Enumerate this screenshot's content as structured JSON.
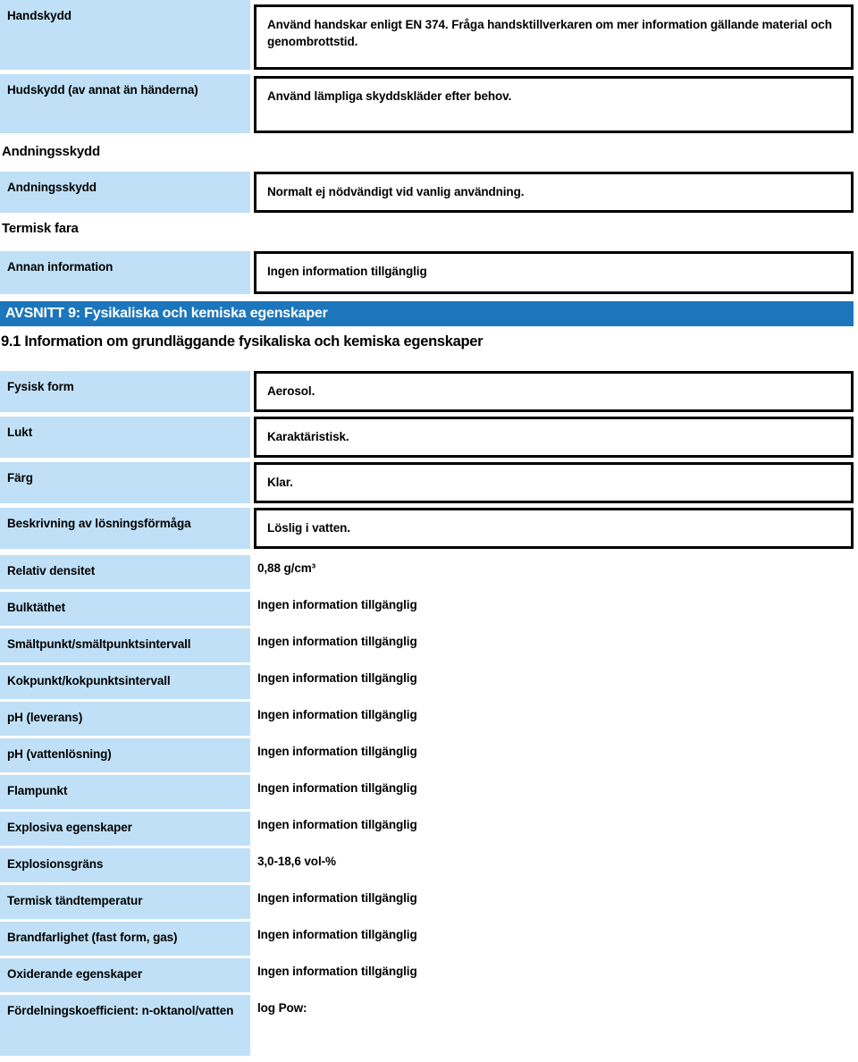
{
  "document": {
    "language": "sv",
    "kind": "safety-data-sheet"
  },
  "colors": {
    "label_cell": "#bfe0f6",
    "banner": "#1c76bc",
    "banner_text": "#ffffff",
    "box_border": "#000000",
    "page_background": "#ffffff",
    "text": "#000000"
  },
  "protection_section": {
    "rows": [
      {
        "label": "Handskydd",
        "value": "Använd handskar enligt EN 374. Fråga handsktillverkaren om mer information gällande material och genombrottstid.",
        "boxed": true
      },
      {
        "label": "Hudskydd (av annat än händerna)",
        "value": "Använd lämpliga skyddskläder efter behov.",
        "boxed": true
      }
    ],
    "subheadings": [
      {
        "text": "Andningsskydd"
      },
      {
        "text": "Termisk fara"
      }
    ],
    "respiratory_row": {
      "label": "Andningsskydd",
      "value": "Normalt ej nödvändigt vid vanlig användning.",
      "boxed": true
    },
    "other_info_row": {
      "label": "Annan information",
      "value": "Ingen information tillgänglig",
      "boxed": true
    }
  },
  "section9": {
    "banner": "AVSNITT 9: Fysikaliska och kemiska egenskaper",
    "subsection_heading": "9.1 Information om grundläggande fysikaliska och kemiska egenskaper",
    "boxed_rows": [
      {
        "label": "Fysisk form",
        "value": "Aerosol."
      },
      {
        "label": "Lukt",
        "value": "Karaktäristisk."
      },
      {
        "label": "Färg",
        "value": "Klar."
      },
      {
        "label": "Beskrivning av lösningsförmåga",
        "value": "Löslig i vatten."
      }
    ],
    "plain_rows": [
      {
        "label": "Relativ densitet",
        "value": "0,88 g/cm³"
      },
      {
        "label": "Bulktäthet",
        "value": "Ingen information tillgänglig"
      },
      {
        "label": "Smältpunkt/smältpunktsintervall",
        "value": "Ingen information tillgänglig"
      },
      {
        "label": "Kokpunkt/kokpunktsintervall",
        "value": "Ingen information tillgänglig"
      },
      {
        "label": "pH (leverans)",
        "value": "Ingen information tillgänglig"
      },
      {
        "label": "pH (vattenlösning)",
        "value": "Ingen information tillgänglig"
      },
      {
        "label": "Flampunkt",
        "value": "Ingen information tillgänglig"
      },
      {
        "label": "Explosiva egenskaper",
        "value": "Ingen information tillgänglig"
      },
      {
        "label": "Explosionsgräns",
        "value": "3,0-18,6 vol-%"
      },
      {
        "label": "Termisk tändtemperatur",
        "value": "Ingen information tillgänglig"
      },
      {
        "label": "Brandfarlighet (fast form, gas)",
        "value": "Ingen information tillgänglig"
      },
      {
        "label": "Oxiderande egenskaper",
        "value": "Ingen information tillgänglig"
      },
      {
        "label": "Fördelningskoefficient: n-oktanol/vatten",
        "value": "log Pow:"
      }
    ]
  }
}
